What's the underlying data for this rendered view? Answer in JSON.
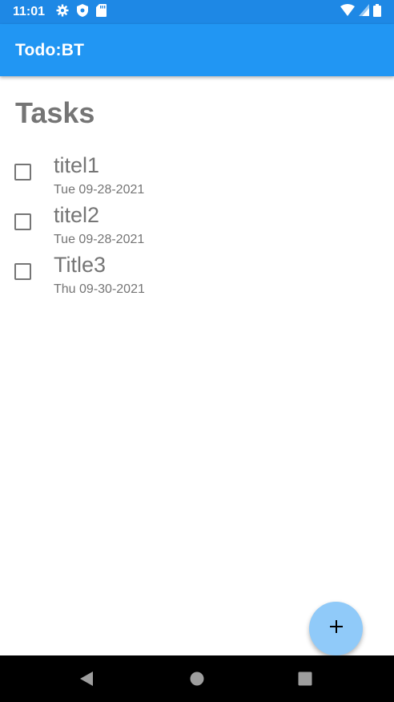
{
  "status_bar": {
    "time": "11:01",
    "icons_left": [
      "gear-icon",
      "shield-icon",
      "sd-card-icon"
    ],
    "icons_right": [
      "wifi-icon",
      "signal-icon",
      "battery-icon"
    ]
  },
  "app_bar": {
    "title": "Todo:BT",
    "color": "#2196f3"
  },
  "page": {
    "heading": "Tasks"
  },
  "tasks": [
    {
      "title": "titel1",
      "date": "Tue 09-28-2021",
      "checked": false
    },
    {
      "title": "titel2",
      "date": "Tue 09-28-2021",
      "checked": false
    },
    {
      "title": "Title3",
      "date": "Thu 09-30-2021",
      "checked": false
    }
  ],
  "fab": {
    "label": "+",
    "icon": "plus-icon",
    "color": "#90caf9"
  },
  "nav_bar": {
    "buttons": [
      "back-icon",
      "home-icon",
      "recents-icon"
    ]
  }
}
